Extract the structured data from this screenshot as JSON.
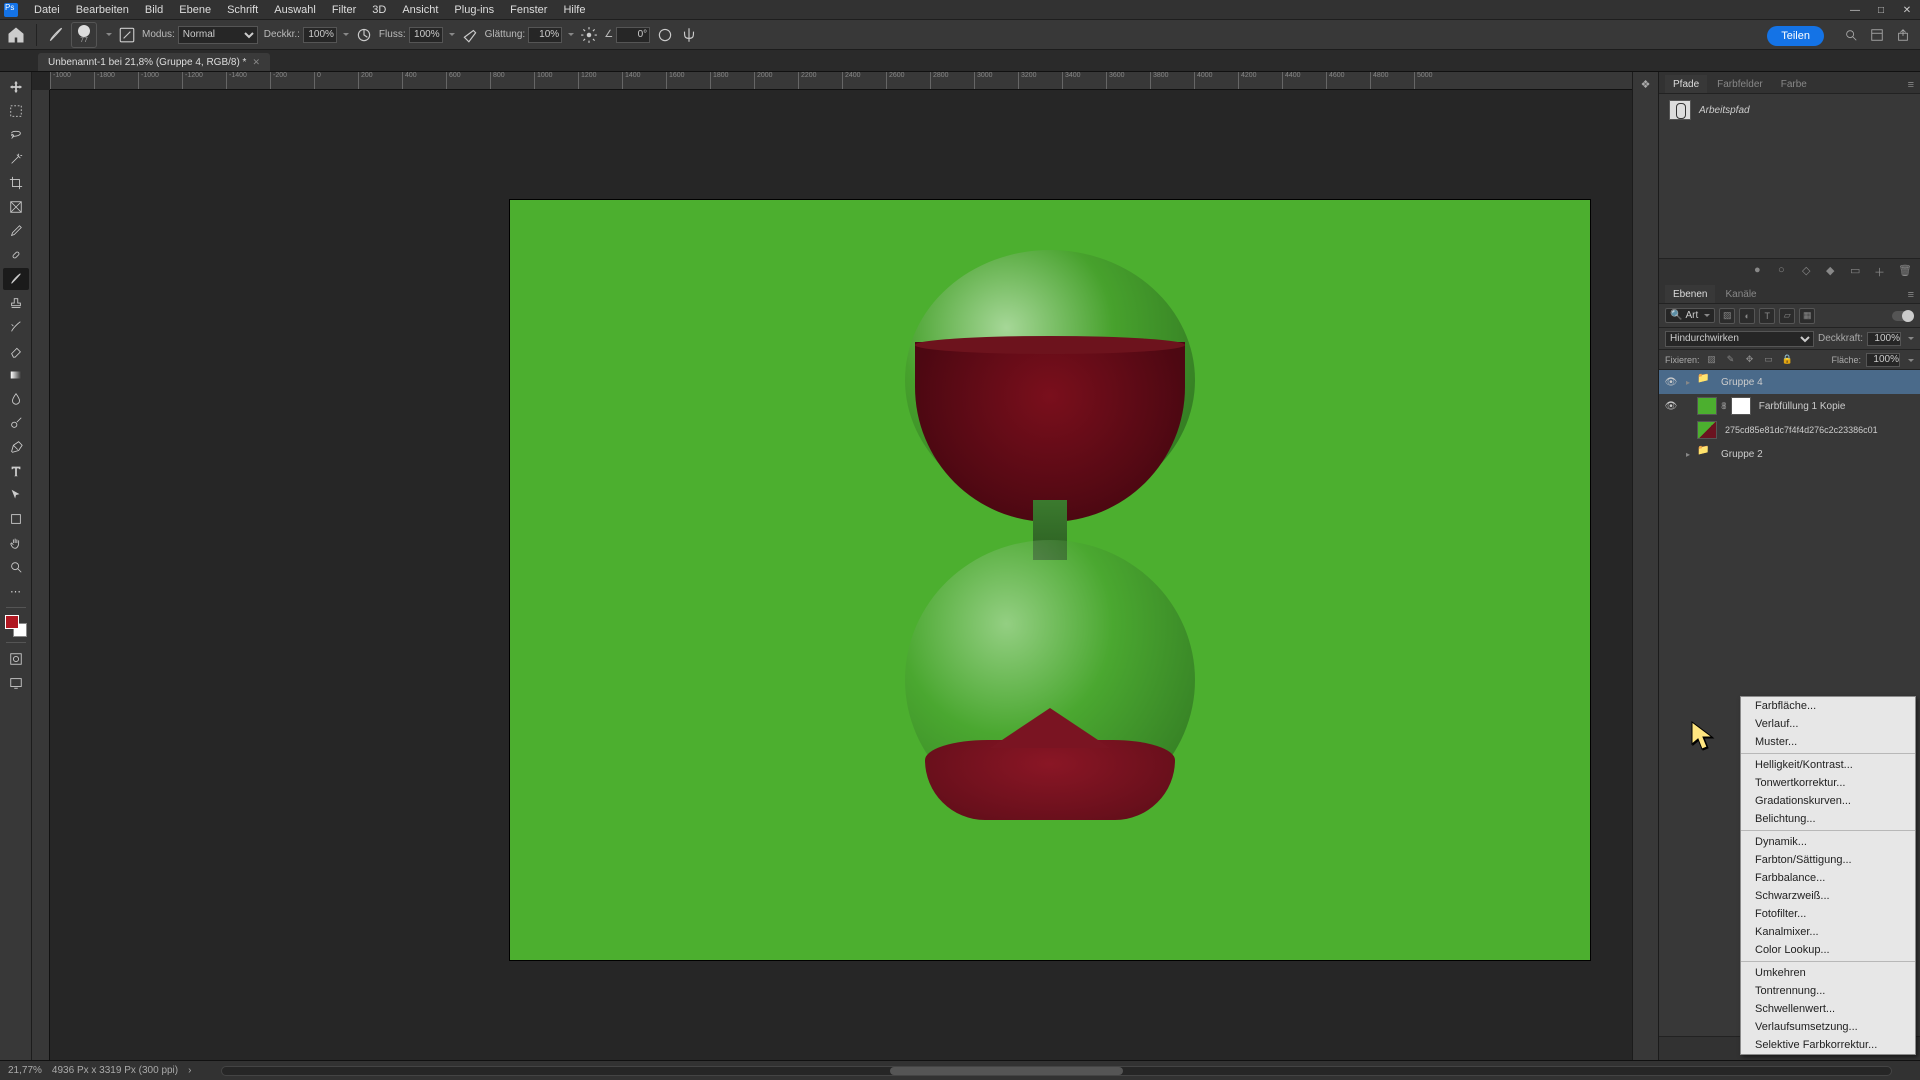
{
  "menubar": [
    "Datei",
    "Bearbeiten",
    "Bild",
    "Ebene",
    "Schrift",
    "Auswahl",
    "Filter",
    "3D",
    "Ansicht",
    "Plug-ins",
    "Fenster",
    "Hilfe"
  ],
  "window_buttons": {
    "min": "—",
    "max": "□",
    "close": "✕"
  },
  "optbar": {
    "brush_size": "77",
    "mode_label": "Modus:",
    "mode_value": "Normal",
    "opacity_label": "Deckkr.:",
    "opacity_value": "100%",
    "flow_label": "Fluss:",
    "flow_value": "100%",
    "smooth_label": "Glättung:",
    "smooth_value": "10%",
    "angle_icon": "∠",
    "angle_value": "0°"
  },
  "share": "Teilen",
  "doc_tab": "Unbenannt-1 bei 21,8% (Gruppe 4, RGB/8) *",
  "ruler_ticks": [
    "-1000",
    "-1800",
    "-1000",
    "-1200",
    "-1400",
    "-200",
    "0",
    "200",
    "400",
    "600",
    "800",
    "1000",
    "1200",
    "1400",
    "1600",
    "1800",
    "2000",
    "2200",
    "2400",
    "2600",
    "2800",
    "3000",
    "3200",
    "3400",
    "3600",
    "3800",
    "4000",
    "4200",
    "4400",
    "4600",
    "4800",
    "5000"
  ],
  "paths_tabs": [
    "Pfade",
    "Farbfelder",
    "Farbe"
  ],
  "paths_item": "Arbeitspfad",
  "layers_tabs": [
    "Ebenen",
    "Kanäle"
  ],
  "layers_filter_kind_label": "Art",
  "blend_mode": "Hindurchwirken",
  "opacity_lbl": "Deckkraft:",
  "opacity_val": "100%",
  "lock_lbl": "Fixieren:",
  "fill_lbl": "Fläche:",
  "fill_val": "100%",
  "layers": [
    {
      "vis": true,
      "type": "group",
      "name": "Gruppe 4",
      "selected": true
    },
    {
      "vis": true,
      "type": "fill",
      "name": "Farbfüllung 1 Kopie"
    },
    {
      "vis": false,
      "type": "image",
      "name": "275cd85e81dc7f4f4d276c2c23386c01"
    },
    {
      "vis": false,
      "type": "group",
      "name": "Gruppe 2"
    }
  ],
  "context_menu": {
    "g1": [
      "Farbfläche...",
      "Verlauf...",
      "Muster..."
    ],
    "g2": [
      "Helligkeit/Kontrast...",
      "Tonwertkorrektur...",
      "Gradationskurven...",
      "Belichtung..."
    ],
    "g3": [
      "Dynamik...",
      "Farbton/Sättigung...",
      "Farbbalance...",
      "Schwarzweiß...",
      "Fotofilter...",
      "Kanalmixer...",
      "Color Lookup..."
    ],
    "g4": [
      "Umkehren",
      "Tontrennung...",
      "Schwellenwert...",
      "Verlaufsumsetzung...",
      "Selektive Farbkorrektur..."
    ]
  },
  "status": {
    "zoom": "21,77%",
    "dims": "4936 Px x 3319 Px (300 ppi)"
  }
}
